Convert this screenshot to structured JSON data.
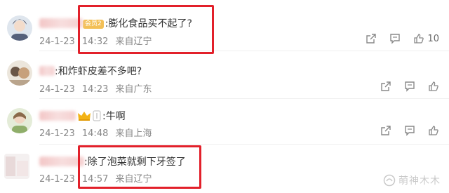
{
  "comments": [
    {
      "badge": "会员2",
      "text": ":膨化食品买不起了?",
      "date": "24-1-23",
      "time": "14:32",
      "location": "来自辽宁",
      "like_count": "10"
    },
    {
      "text": ":和炸虾皮差不多吧?",
      "date": "24-1-23",
      "time": "14:23",
      "location": "来自广东"
    },
    {
      "text": ":牛啊",
      "date": "24-1-23",
      "time": "14:48",
      "location": "来自上海"
    },
    {
      "text": ":除了泡菜就剩下牙签了",
      "date": "24-1-23",
      "time": "14:57",
      "location": "来自辽宁"
    }
  ],
  "watermark": "萌神木木",
  "colors": {
    "highlight_box": "#e2202a",
    "username": "#eb7350",
    "meta": "#888888"
  },
  "icons": {
    "share": "share-icon",
    "reply": "reply-icon",
    "like": "like-icon"
  }
}
